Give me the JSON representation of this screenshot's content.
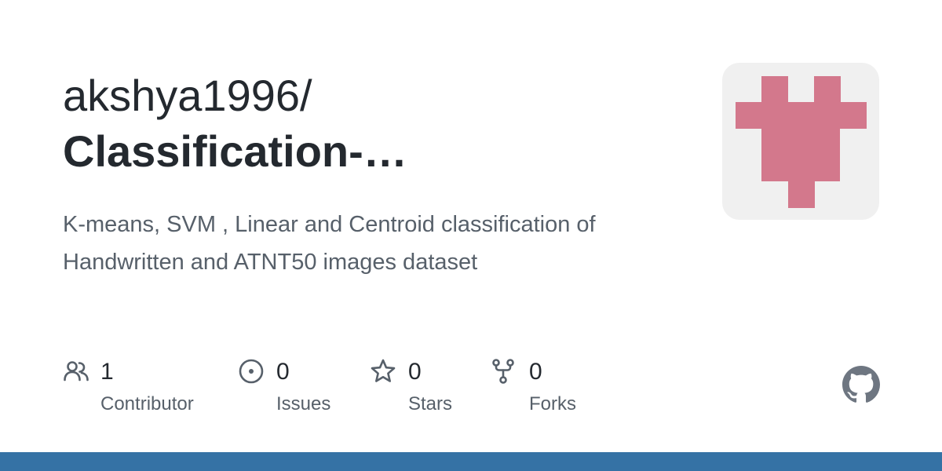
{
  "repo": {
    "owner": "akshya1996/",
    "name": "Classification-…",
    "description": "K-means, SVM , Linear and Centroid classification of Handwritten and ATNT50 images dataset"
  },
  "avatar": {
    "icon": "identicon-avatar",
    "color": "#d3788c",
    "background": "#f0f0f0"
  },
  "stats": {
    "contributors": {
      "count": "1",
      "label": "Contributor",
      "icon": "people-icon"
    },
    "issues": {
      "count": "0",
      "label": "Issues",
      "icon": "issue-opened-icon"
    },
    "stars": {
      "count": "0",
      "label": "Stars",
      "icon": "star-icon"
    },
    "forks": {
      "count": "0",
      "label": "Forks",
      "icon": "repo-forked-icon"
    }
  },
  "branding": {
    "icon": "github-mark-icon",
    "icon_color": "#6e7681"
  },
  "colors": {
    "bottom_bar": "#3572a5",
    "title": "#24292f",
    "muted": "#57606a"
  }
}
